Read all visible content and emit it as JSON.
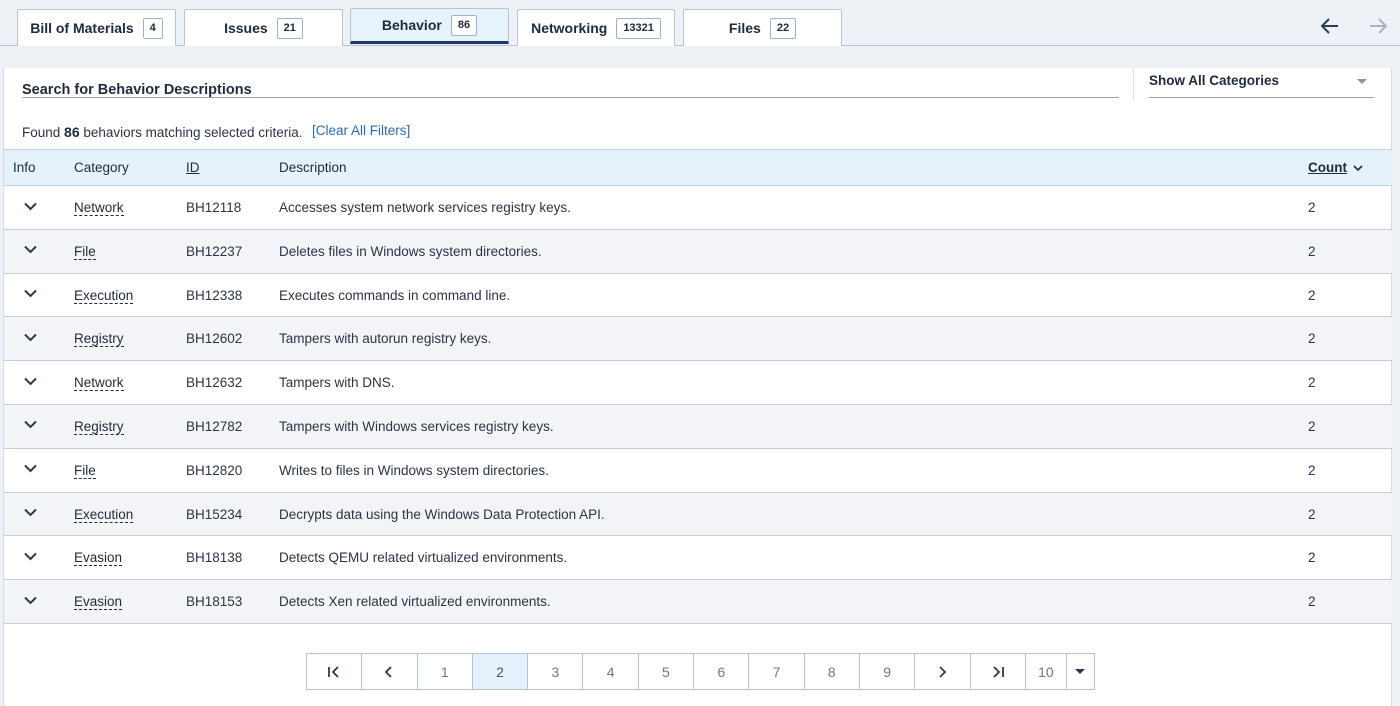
{
  "tabs": [
    {
      "label": "Bill of Materials",
      "count": "4"
    },
    {
      "label": "Issues",
      "count": "21"
    },
    {
      "label": "Behavior",
      "count": "86"
    },
    {
      "label": "Networking",
      "count": "13321"
    },
    {
      "label": "Files",
      "count": "22"
    }
  ],
  "active_tab": "Behavior",
  "nav": {
    "back_icon": "arrow-left-icon",
    "forward_icon": "arrow-right-icon"
  },
  "search": {
    "label": "Search for Behavior Descriptions"
  },
  "category_filter": {
    "selected": "Show All Categories"
  },
  "results": {
    "prefix": "Found",
    "count": "86",
    "suffix": "behaviors matching selected criteria.",
    "clear_label": "[Clear All Filters]"
  },
  "table": {
    "headers": {
      "info": "Info",
      "category": "Category",
      "id": "ID",
      "description": "Description",
      "count": "Count"
    },
    "rows": [
      {
        "category": "Network",
        "id": "BH12118",
        "description": "Accesses system network services registry keys.",
        "count": "2"
      },
      {
        "category": "File",
        "id": "BH12237",
        "description": "Deletes files in Windows system directories.",
        "count": "2"
      },
      {
        "category": "Execution",
        "id": "BH12338",
        "description": "Executes commands in command line.",
        "count": "2"
      },
      {
        "category": "Registry",
        "id": "BH12602",
        "description": "Tampers with autorun registry keys.",
        "count": "2"
      },
      {
        "category": "Network",
        "id": "BH12632",
        "description": "Tampers with DNS.",
        "count": "2"
      },
      {
        "category": "Registry",
        "id": "BH12782",
        "description": "Tampers with Windows services registry keys.",
        "count": "2"
      },
      {
        "category": "File",
        "id": "BH12820",
        "description": "Writes to files in Windows system directories.",
        "count": "2"
      },
      {
        "category": "Execution",
        "id": "BH15234",
        "description": "Decrypts data using the Windows Data Protection API.",
        "count": "2"
      },
      {
        "category": "Evasion",
        "id": "BH18138",
        "description": "Detects QEMU related virtualized environments.",
        "count": "2"
      },
      {
        "category": "Evasion",
        "id": "BH18153",
        "description": "Detects Xen related virtualized environments.",
        "count": "2"
      }
    ]
  },
  "pagination": {
    "pages": [
      "1",
      "2",
      "3",
      "4",
      "5",
      "6",
      "7",
      "8",
      "9"
    ],
    "current": "2",
    "page_size": "10"
  }
}
